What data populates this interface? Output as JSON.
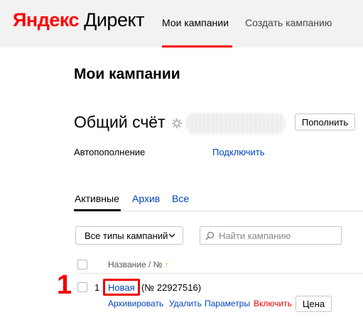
{
  "header": {
    "logo_brand": "Яндекс",
    "logo_product": "Директ",
    "nav": [
      {
        "label": "Мои кампании",
        "active": true
      },
      {
        "label": "Создать кампанию",
        "active": false
      }
    ]
  },
  "page_title": "Мои кампании",
  "account": {
    "title": "Общий счёт",
    "topup_button": "Пополнить",
    "autopay_label": "Автопополнение",
    "autopay_link": "Подключить"
  },
  "tabs": [
    {
      "label": "Активные",
      "active": true
    },
    {
      "label": "Архив",
      "active": false
    },
    {
      "label": "Все",
      "active": false
    }
  ],
  "filters": {
    "type_select": "Все типы кампаний",
    "search_placeholder": "Найти кампанию"
  },
  "table": {
    "column_header": "Название / №",
    "sort_arrow": "↑"
  },
  "campaigns": [
    {
      "index": "1",
      "name": "Новая",
      "number": "(№ 22927516)",
      "actions": [
        "Архивировать",
        "Удалить",
        "Параметры",
        "Включить"
      ],
      "price_button": "Цена"
    }
  ],
  "annotation": {
    "label": "1",
    "color": "#e00000"
  },
  "colors": {
    "brand_red": "#ff0000",
    "link_blue": "#0044bb",
    "header_bg": "#f2f2f2"
  }
}
